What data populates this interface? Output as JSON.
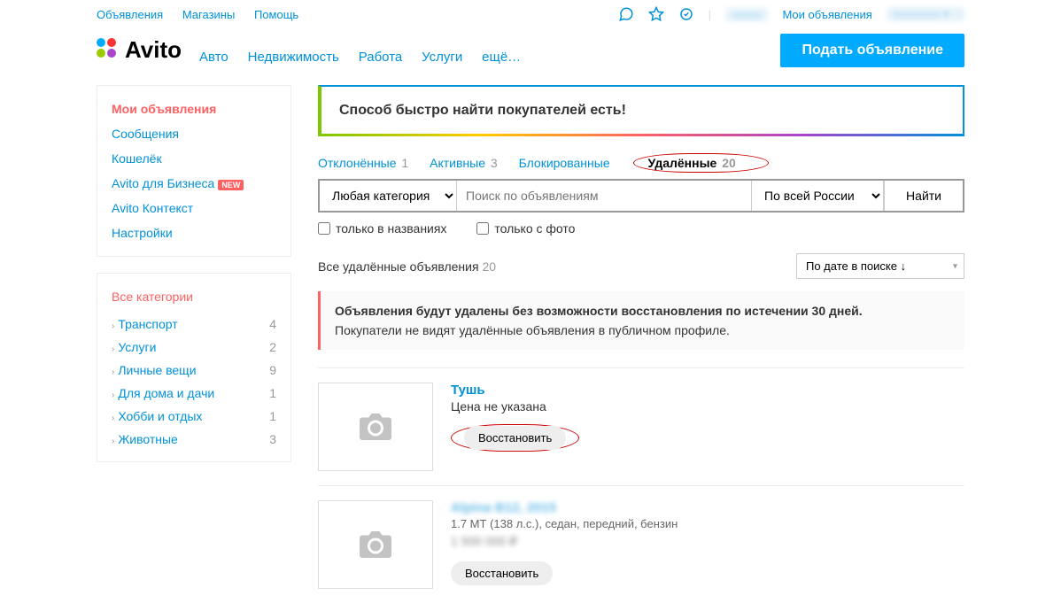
{
  "top": {
    "links": [
      "Объявления",
      "Магазины",
      "Помощь"
    ],
    "my_ads": "Мои объявления"
  },
  "header": {
    "logo": "Avito",
    "nav": [
      "Авто",
      "Недвижимость",
      "Работа",
      "Услуги",
      "ещё…"
    ],
    "post_button": "Подать объявление"
  },
  "sidebar_menu": {
    "items": [
      {
        "label": "Мои объявления",
        "active": true
      },
      {
        "label": "Сообщения"
      },
      {
        "label": "Кошелёк"
      },
      {
        "label": "Avito для Бизнеса",
        "badge": "NEW"
      },
      {
        "label": "Avito Контекст"
      },
      {
        "label": "Настройки"
      }
    ]
  },
  "categories": {
    "header": "Все категории",
    "items": [
      {
        "label": "Транспорт",
        "count": 4
      },
      {
        "label": "Услуги",
        "count": 2
      },
      {
        "label": "Личные вещи",
        "count": 9
      },
      {
        "label": "Для дома и дачи",
        "count": 1
      },
      {
        "label": "Хобби и отдых",
        "count": 1
      },
      {
        "label": "Животные",
        "count": 3
      }
    ]
  },
  "banner": "Способ быстро найти покупателей есть!",
  "tabs": [
    {
      "label": "Отклонённые",
      "count": 1
    },
    {
      "label": "Активные",
      "count": 3
    },
    {
      "label": "Блокированные",
      "count": ""
    },
    {
      "label": "Удалённые",
      "count": 20,
      "active": true
    }
  ],
  "filter": {
    "category": "Любая категория",
    "search_placeholder": "Поиск по объявлениям",
    "region": "По всей России",
    "find": "Найти",
    "only_titles": "только в названиях",
    "only_photo": "только с фото"
  },
  "summary": {
    "text": "Все удалённые объявления",
    "count": 20,
    "sort": "По дате в поиске ↓"
  },
  "notice": {
    "title": "Объявления будут удалены без возможности восстановления по истечении 30 дней.",
    "text": "Покупатели не видят удалённые объявления в публичном профиле."
  },
  "listings": [
    {
      "title": "Тушь",
      "price": "Цена не указана",
      "desc": "",
      "restore": "Восстановить",
      "highlighted": true
    },
    {
      "title": "Alpina B12, 2015",
      "price": "1 500 000 ₽",
      "desc": "1.7 МТ (138 л.с.), седан, передний, бензин",
      "restore": "Восстановить",
      "blurred": true
    }
  ]
}
